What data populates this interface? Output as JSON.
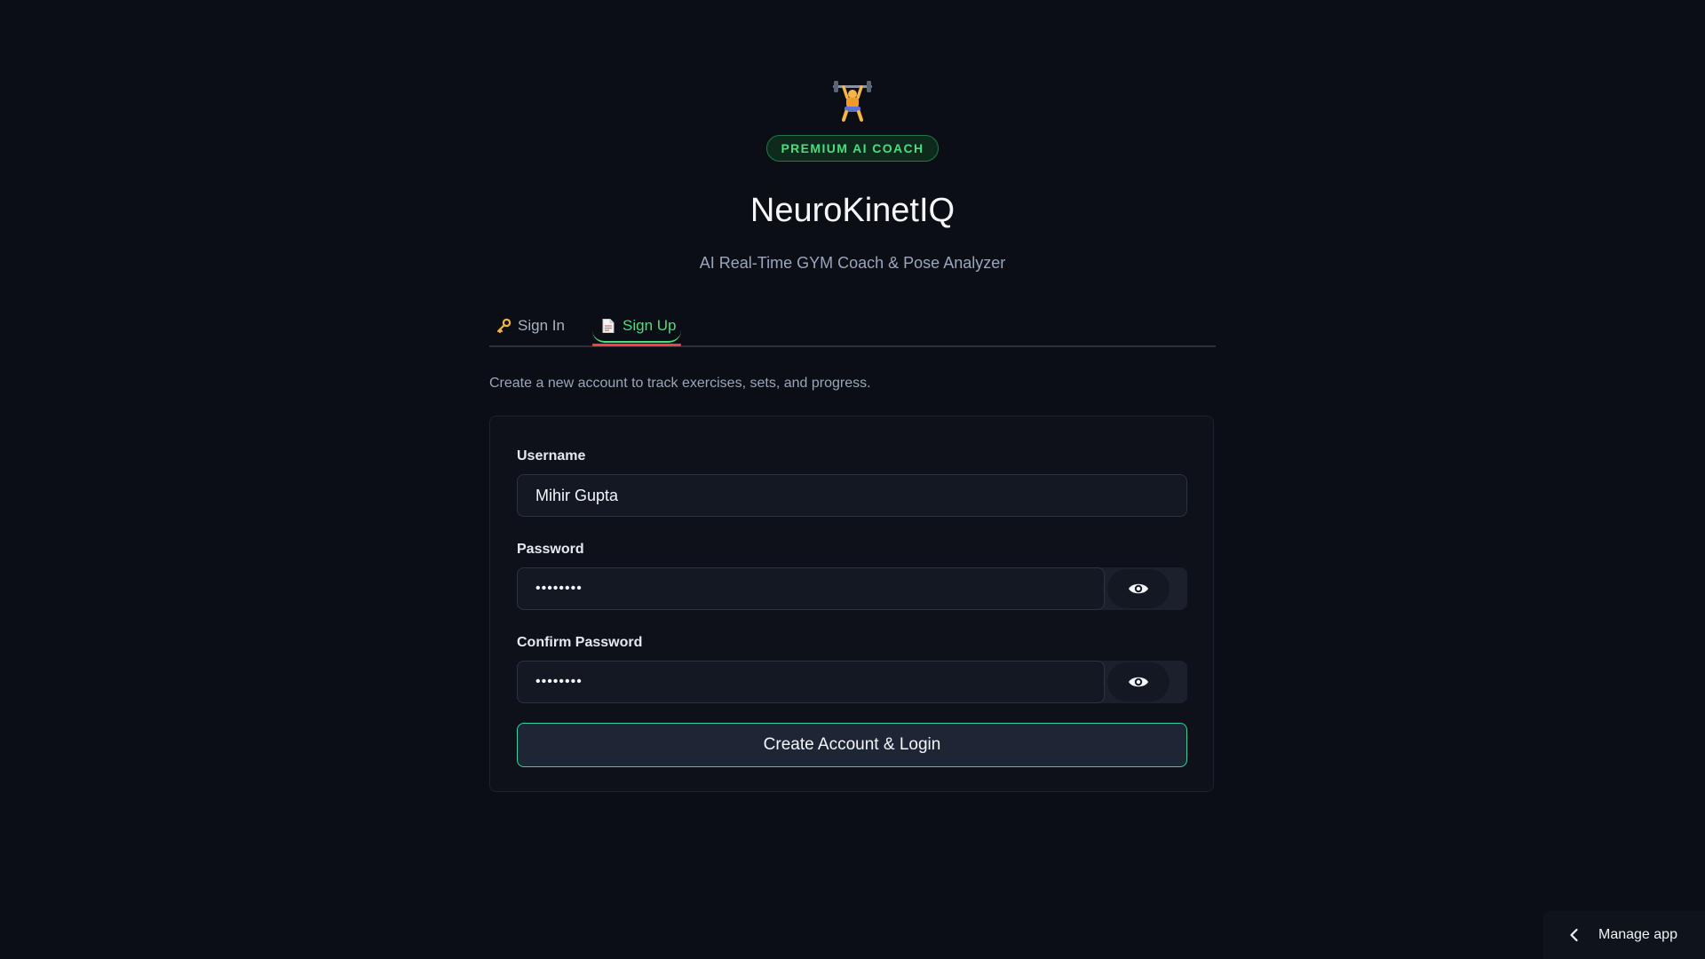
{
  "header": {
    "logo_icon": "weightlifter-icon",
    "badge": "PREMIUM AI COACH",
    "title": "NeuroKinetIQ",
    "subtitle": "AI Real-Time GYM Coach & Pose Analyzer"
  },
  "tabs": [
    {
      "icon": "key-icon",
      "label": "Sign In",
      "active": false
    },
    {
      "icon": "page-icon",
      "label": "Sign Up",
      "active": true
    }
  ],
  "intro": "Create a new account to track exercises, sets, and progress.",
  "form": {
    "username_label": "Username",
    "username_value": "Mihir Gupta",
    "password_label": "Password",
    "password_value": "••••••••",
    "confirm_label": "Confirm Password",
    "confirm_value": "••••••••",
    "toggle_icon": "eye-icon",
    "submit_label": "Create Account & Login"
  },
  "footer": {
    "manage_label": "Manage app",
    "manage_icon": "chevron-left-icon"
  },
  "colors": {
    "background": "#0b0e14",
    "accent_green": "#4ade80",
    "active_underline": "#ef4444"
  }
}
